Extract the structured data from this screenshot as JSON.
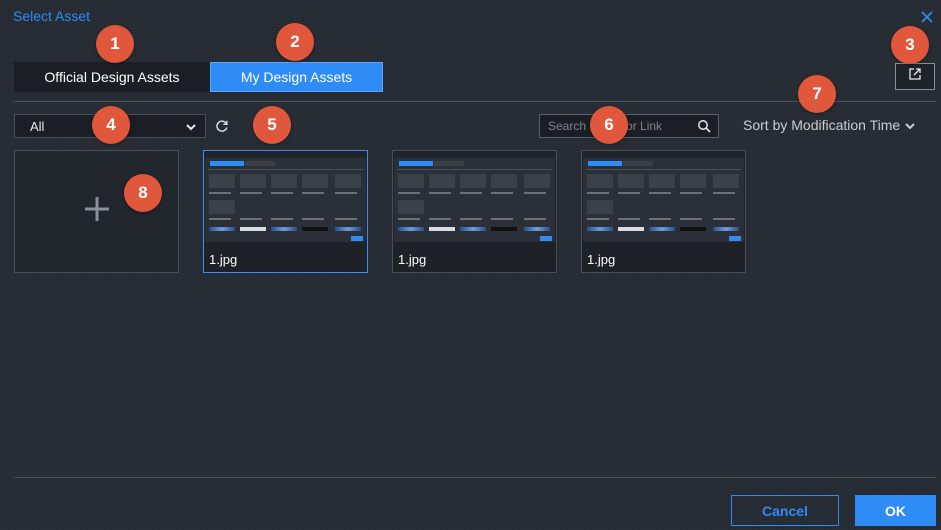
{
  "dialog": {
    "title": "Select Asset"
  },
  "tabs": [
    {
      "label": "Official Design Assets",
      "active": false
    },
    {
      "label": "My Design Assets",
      "active": true
    }
  ],
  "filter": {
    "selected": "All"
  },
  "search": {
    "placeholder": "Search Image or Link"
  },
  "sort": {
    "label": "Sort by Modification Time"
  },
  "assets": [
    {
      "name": "1.jpg",
      "selected": true
    },
    {
      "name": "1.jpg",
      "selected": false
    },
    {
      "name": "1.jpg",
      "selected": false
    }
  ],
  "callouts": [
    "1",
    "2",
    "3",
    "4",
    "5",
    "6",
    "7",
    "8"
  ],
  "footer": {
    "cancel_label": "Cancel",
    "ok_label": "OK"
  },
  "colors": {
    "accent": "#2f8cf6",
    "callout": "#e0573c",
    "background": "#262b33"
  },
  "icons": [
    "close-icon",
    "external-link-icon",
    "chevron-down-icon",
    "refresh-icon",
    "search-icon",
    "plus-icon"
  ]
}
